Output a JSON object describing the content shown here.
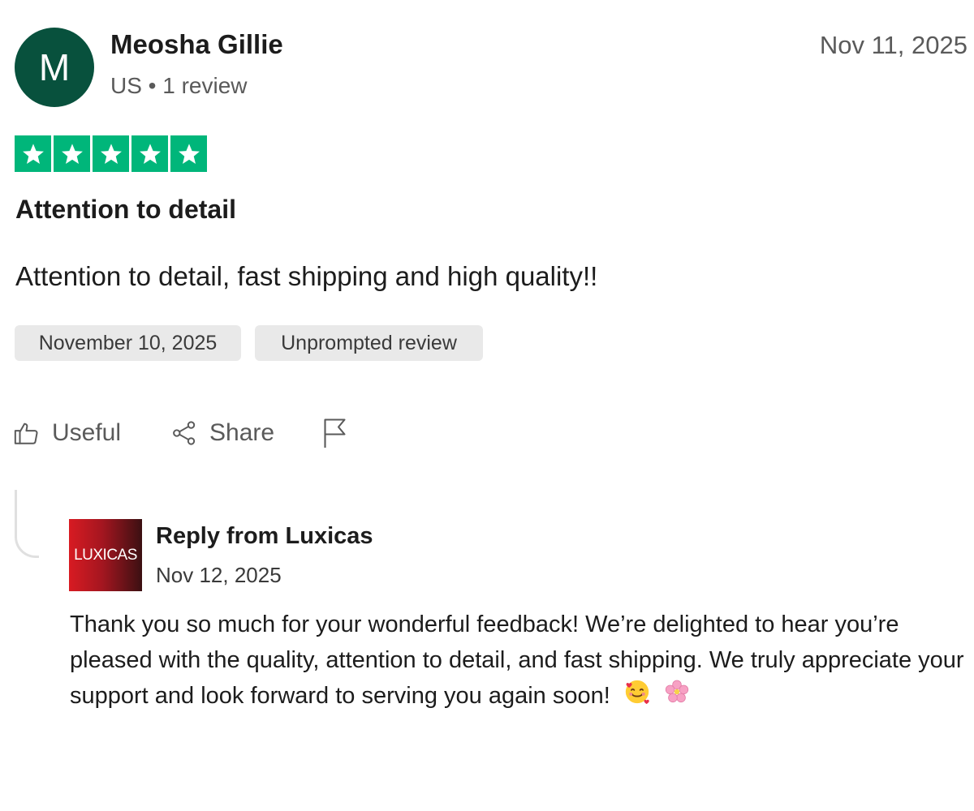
{
  "review": {
    "avatar_initial": "M",
    "reviewer_name": "Meosha Gillie",
    "reviewer_meta": "US • 1 review",
    "date": "Nov 11, 2025",
    "rating": 5,
    "rating_max": 5,
    "star_color": "#00b67a",
    "title": "Attention to detail",
    "body": "Attention to detail, fast shipping and high quality!!",
    "tags": {
      "experience_date": "November 10, 2025",
      "review_type": "Unprompted review"
    },
    "actions": {
      "useful_label": "Useful",
      "share_label": "Share",
      "flag_icon": "flag-icon"
    }
  },
  "reply": {
    "logo_text": "LUXICAS",
    "title": "Reply from Luxicas",
    "date": "Nov 12, 2025",
    "body": "Thank you so much for your wonderful feedback! We’re delighted to hear you’re pleased with the quality, attention to detail, and fast shipping. We truly appreciate your support and look forward to serving you again soon!",
    "emojis": [
      "smiling-face-with-hearts-emoji",
      "cherry-blossom-emoji"
    ]
  },
  "colors": {
    "avatar_bg": "#08513d",
    "tag_bg": "#e9e9e9",
    "logo_red": "#d81b22"
  }
}
